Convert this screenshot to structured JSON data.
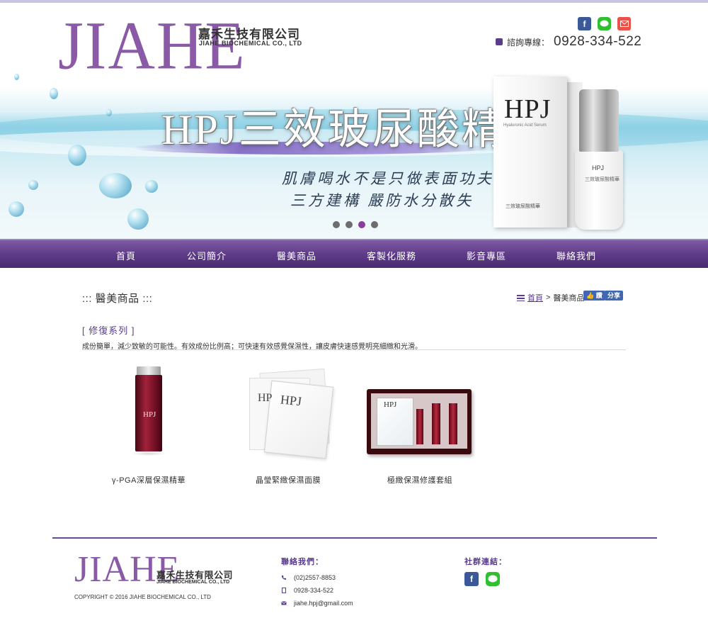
{
  "header": {
    "logo": "JIAHE",
    "company_cn": "嘉禾生技有限公司",
    "company_en": "JIAHE BIOCHEMICAL CO., LTD",
    "hotline_label": "諮詢專線：",
    "hotline_number": "0928-334-522",
    "social_icons": [
      "facebook-icon",
      "line-icon",
      "mail-icon"
    ]
  },
  "banner": {
    "headline": "HPJ三效玻尿酸精華",
    "line1": "肌膚喝水不是只做表面功夫",
    "line2": "三方建構 嚴防水分散失",
    "box_brand": "HPJ",
    "box_sub": "Hyaluronic Acid Serum",
    "box_cn": "三效玻尿酸精華",
    "bottle_brand": "HPJ",
    "bottle_cn": "三效玻尿酸精華",
    "slide_count": 4,
    "active_slide": 3
  },
  "nav": {
    "items": [
      "首頁",
      "公司簡介",
      "醫美商品",
      "客製化服務",
      "影音專區",
      "聯絡我們"
    ]
  },
  "content": {
    "title": "::: 醫美商品 :::",
    "breadcrumb_home": "首頁",
    "breadcrumb_sep": ">",
    "breadcrumb_current": "醫美商品",
    "like_label": "讚",
    "share_label": "分享",
    "series_title": "[ 修復系列 ]",
    "series_desc": "成份簡單，減少致敏的可能性。有效成份比例高；可快速有效感覺保濕性，讓皮膚快速感覺明亮細緻和光滑。",
    "products": [
      {
        "name": "γ-PGA深層保濕精華"
      },
      {
        "name": "晶瑩緊緻保濕面膜"
      },
      {
        "name": "極緻保濕修護套組"
      }
    ]
  },
  "footer": {
    "logo": "JIAHE",
    "company_cn": "嘉禾生技有限公司",
    "company_en": "JIAHE BIOCHEMICAL CO., LTD",
    "copyright": "COPYRIGHT © 2016 JIAHE BIOCHEMICAL CO., LTD",
    "contact_title": "聯絡我們：",
    "phone": "(02)2557-8853",
    "mobile": "0928-334-522",
    "email": "jiahe.hpj@gmail.com",
    "social_title": "社群連結："
  },
  "colors": {
    "brand_purple": "#5a3c8c",
    "logo_purple": "#8a5aa6",
    "facebook": "#3b5998",
    "line": "#2fc02f",
    "mail": "#e8544a"
  }
}
